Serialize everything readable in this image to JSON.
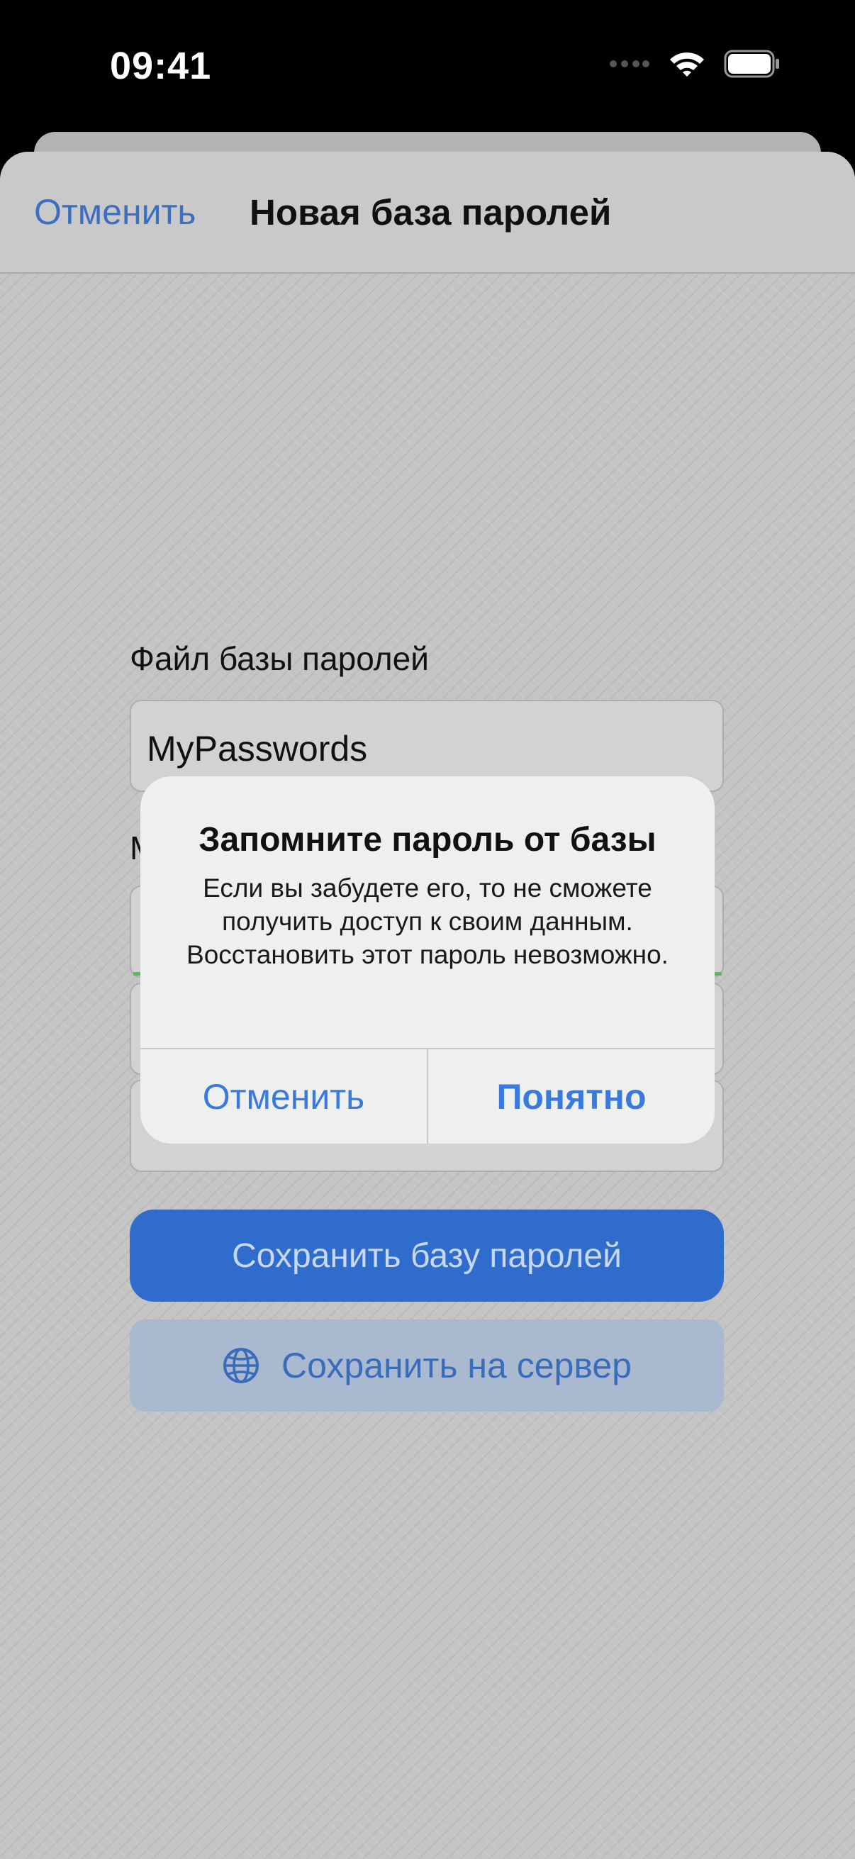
{
  "status_bar": {
    "time": "09:41"
  },
  "navbar": {
    "cancel_label": "Отменить",
    "title": "Новая база паролей"
  },
  "form": {
    "file_label": "Файл базы паролей",
    "file_value": "MyPasswords",
    "password_label_partial": "М"
  },
  "buttons": {
    "save_db_label": "Сохранить базу паролей",
    "save_server_label": "Сохранить на сервер"
  },
  "alert": {
    "title": "Запомните пароль от базы",
    "message": "Если вы забудете его, то не сможете получить доступ к своим данным. Восстановить этот пароль невозможно.",
    "cancel_label": "Отменить",
    "ok_label": "Понятно"
  },
  "colors": {
    "accent": "#3a79dd",
    "primary_button": "#2f6ccc",
    "strength_ok": "#5fb858"
  }
}
